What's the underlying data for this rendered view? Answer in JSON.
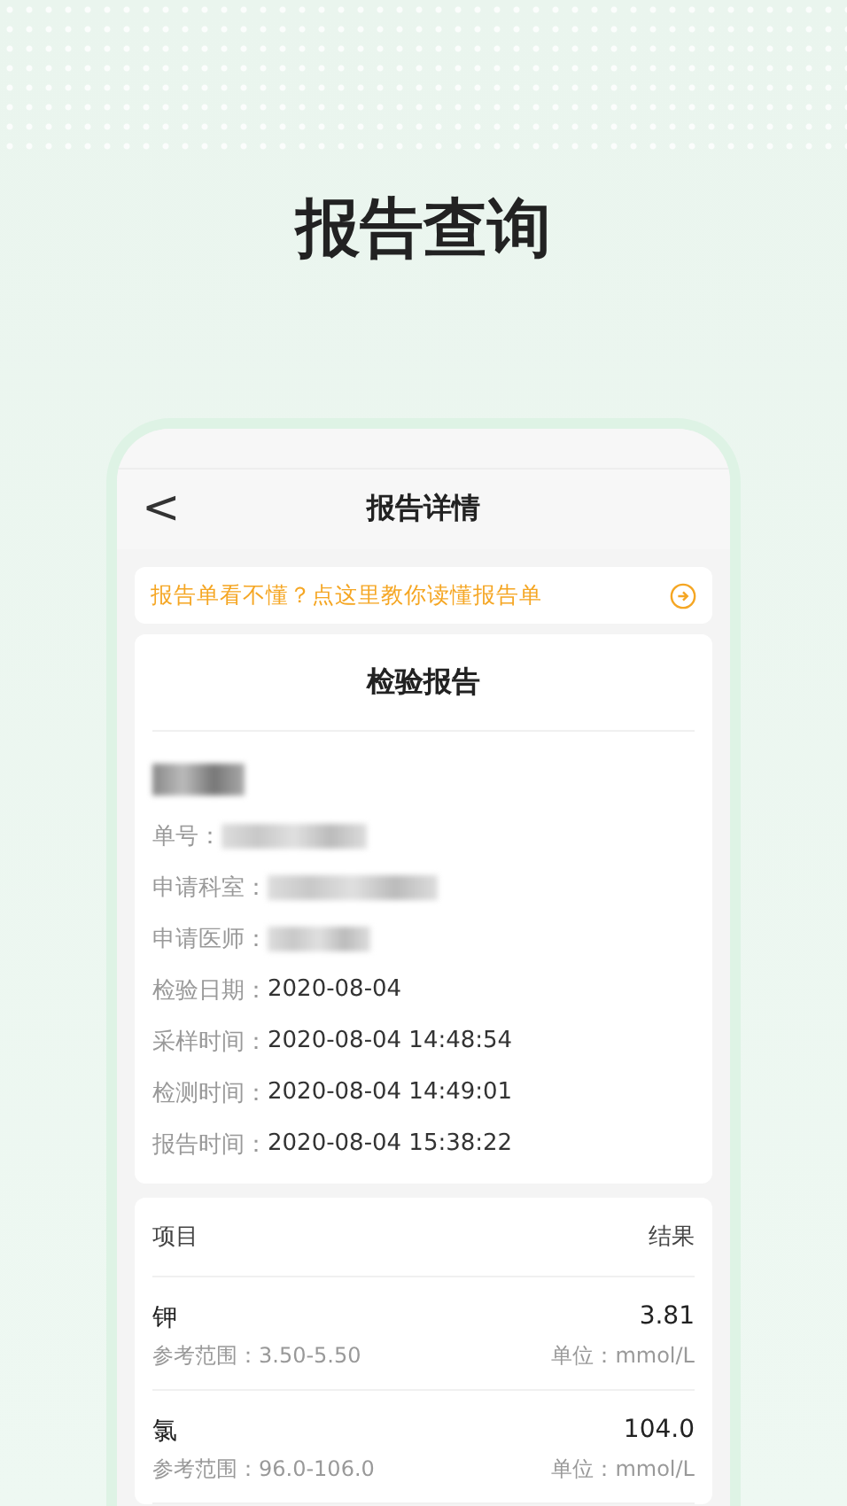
{
  "headline": "报告查询",
  "nav": {
    "back": "<",
    "title": "报告详情"
  },
  "tip": {
    "text": "报告单看不懂？点这里教你读懂报告单"
  },
  "report": {
    "title": "检验报告",
    "fields": [
      {
        "label": "单号：",
        "kind": "redacted"
      },
      {
        "label": "申请科室：",
        "kind": "redacted"
      },
      {
        "label": "申请医师：",
        "kind": "redacted"
      },
      {
        "label": "检验日期：",
        "kind": "text",
        "value": "2020-08-04"
      },
      {
        "label": "采样时间：",
        "kind": "text",
        "value": "2020-08-04 14:48:54"
      },
      {
        "label": "检测时间：",
        "kind": "text",
        "value": "2020-08-04 14:49:01"
      },
      {
        "label": "报告时间：",
        "kind": "text",
        "value": "2020-08-04 15:38:22"
      }
    ]
  },
  "results": {
    "columns": [
      "项目",
      "结果"
    ],
    "rows": [
      {
        "name": "钾",
        "value": "3.81",
        "range": "参考范围：3.50-5.50",
        "unit": "单位：mmol/L"
      },
      {
        "name": "氯",
        "value": "104.0",
        "range": "参考范围：96.0-106.0",
        "unit": "单位：mmol/L"
      }
    ]
  }
}
